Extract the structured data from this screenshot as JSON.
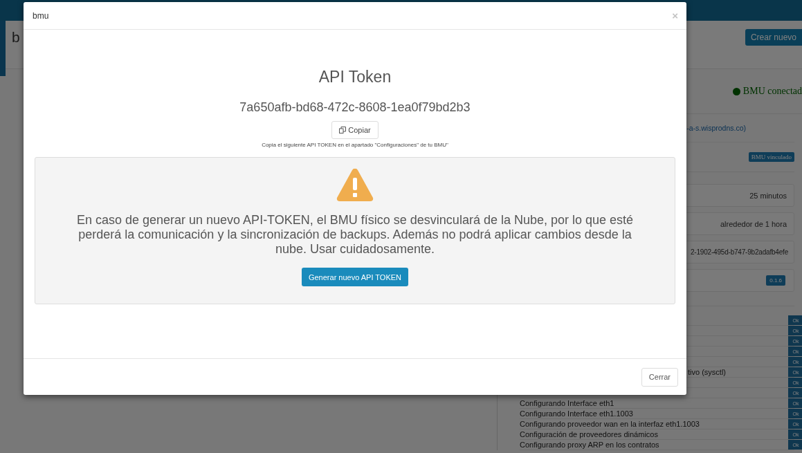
{
  "page": {
    "title": "b",
    "create_button": "Crear nuevo",
    "status": "BMU conectad",
    "link": "-a-s.wisprodns.co)",
    "badge": "BMU vinculado",
    "fields": [
      "25 minutos",
      "alrededor de 1 hora",
      "2-1902-495d-b747-9b2adafb4efe"
    ],
    "version": "0.1.6",
    "steps": [
      {
        "kind": "hidden",
        "status": "Ok"
      },
      {
        "kind": "hidden",
        "status": "Ok"
      },
      {
        "kind": "hidden",
        "status": "Ok"
      },
      {
        "kind": "hidden",
        "status": "Ok"
      },
      {
        "kind": "hidden",
        "status": "Ok"
      },
      {
        "kind": "clipped",
        "text": "tivo (sysctl)",
        "status": "Ok"
      },
      {
        "kind": "hidden",
        "status": "Ok"
      },
      {
        "kind": "hidden",
        "status": "Ok"
      },
      {
        "kind": "full",
        "text": "Configurando Interface eth1",
        "status": "Ok"
      },
      {
        "kind": "full",
        "text": "Configurando Interface eth1.1003",
        "status": "Ok"
      },
      {
        "kind": "full",
        "text": "Configurando proveedor wan en la interfaz eth1.1003",
        "status": "Ok"
      },
      {
        "kind": "full",
        "text": "Configuración de proveedores dinámicos",
        "status": "Ok"
      },
      {
        "kind": "full",
        "text": "Configurando proxy ARP en los contratos",
        "status": "Ok"
      }
    ]
  },
  "modal": {
    "title": "bmu",
    "close": "×",
    "heading": "API Token",
    "token": "7a650afb-bd68-472c-8608-1ea0f79bd2b3",
    "copy_button": "Copiar",
    "hint": "Copia el siguiente API TOKEN en el apartado \"Configuraciones\" de tu BMU\"",
    "warning": {
      "text": "En caso de generar un nuevo API-TOKEN, el BMU físico se desvinculará de la Nube, por lo que esté perderá la comunicación y la sincronización de backups. Además no podrá aplicar cambios desde la nube. Usar cuidadosamente.",
      "button": "Generar nuevo API TOKEN"
    },
    "footer_button": "Cerrar"
  }
}
